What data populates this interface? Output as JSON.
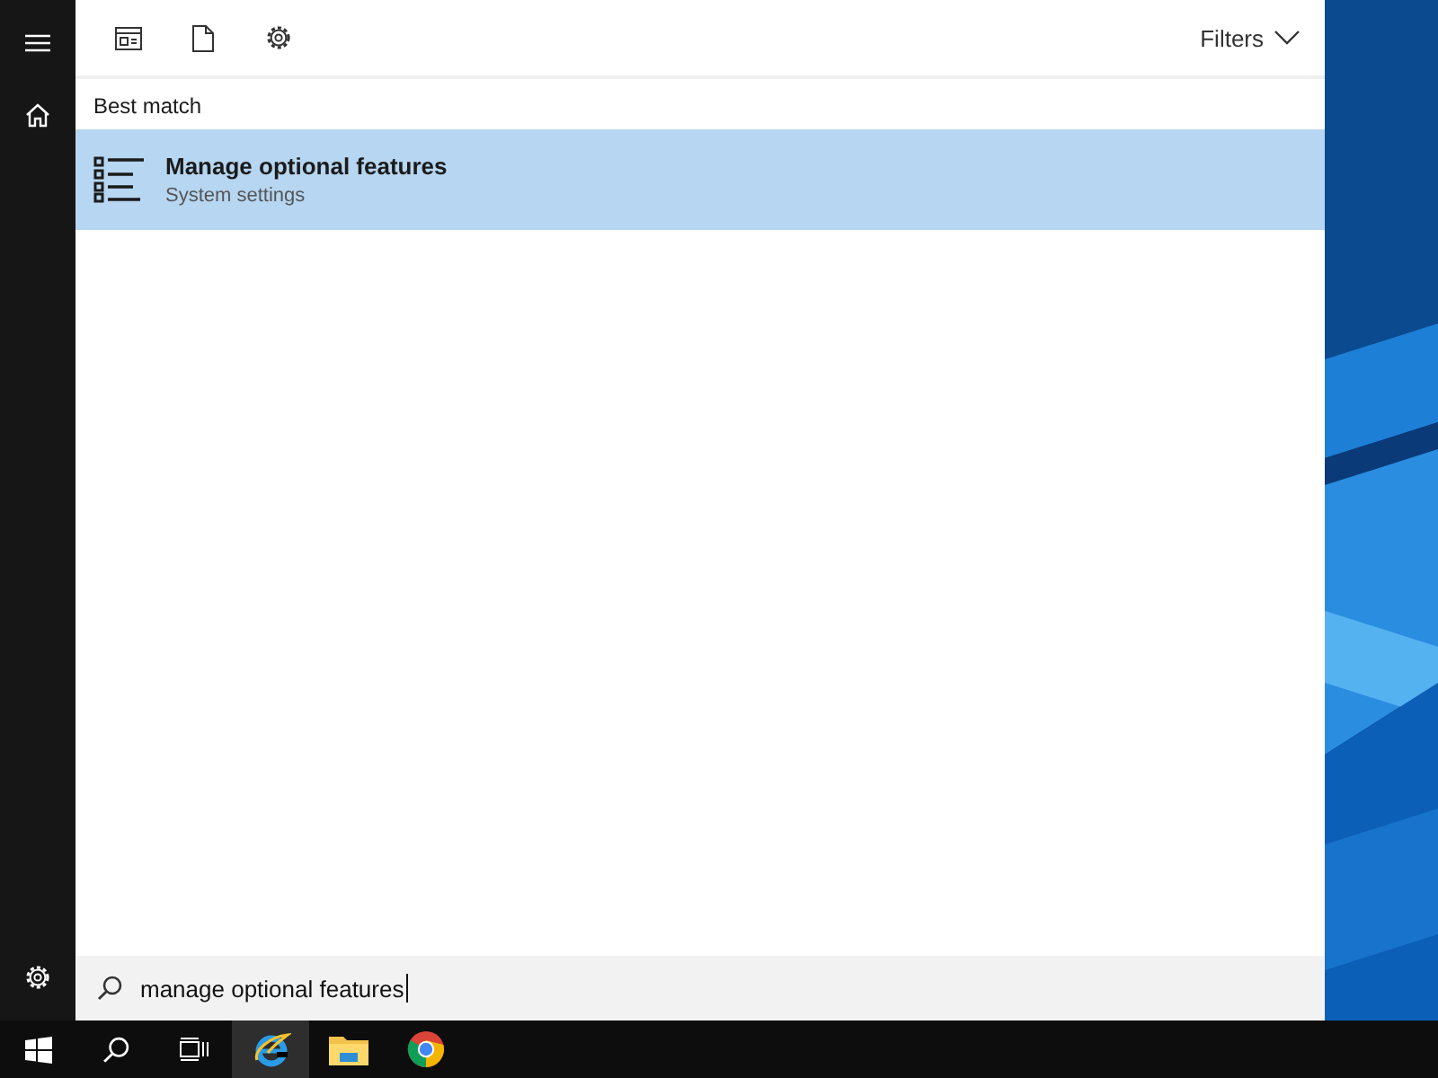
{
  "search_panel": {
    "filters_label": "Filters",
    "section_title": "Best match",
    "results": [
      {
        "title": "Manage optional features",
        "subtitle": "System settings",
        "selected": true
      }
    ],
    "search_box": {
      "value": "manage optional features"
    }
  },
  "taskbar": {
    "apps": [
      {
        "kind": "browser",
        "active": true
      },
      {
        "kind": "folder",
        "active": false
      },
      {
        "kind": "chrome",
        "active": false
      }
    ]
  }
}
